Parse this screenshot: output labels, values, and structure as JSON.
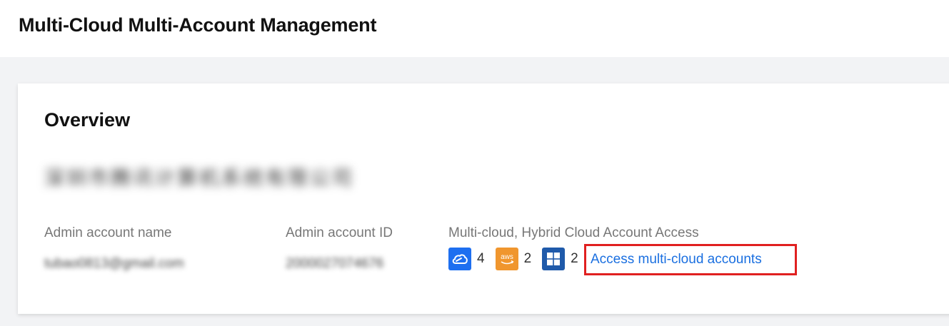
{
  "header": {
    "title": "Multi-Cloud Multi-Account Management"
  },
  "overview": {
    "title": "Overview",
    "org_name": "深圳市腾讯计算机系统有限公司",
    "fields": {
      "admin_name_label": "Admin account name",
      "admin_name_value": "tubao0813@gmail.com",
      "admin_id_label": "Admin account ID",
      "admin_id_value": "2000027074676",
      "access_label": "Multi-cloud, Hybrid Cloud Account Access"
    },
    "clouds": [
      {
        "icon": "tencent-cloud-icon",
        "color": "#1e6ff0",
        "count": "4"
      },
      {
        "icon": "aws-icon",
        "color": "#f0962e",
        "count": "2"
      },
      {
        "icon": "azure-windows-icon",
        "color": "#1f5aaa",
        "count": "2"
      }
    ],
    "access_link": "Access multi-cloud accounts"
  }
}
